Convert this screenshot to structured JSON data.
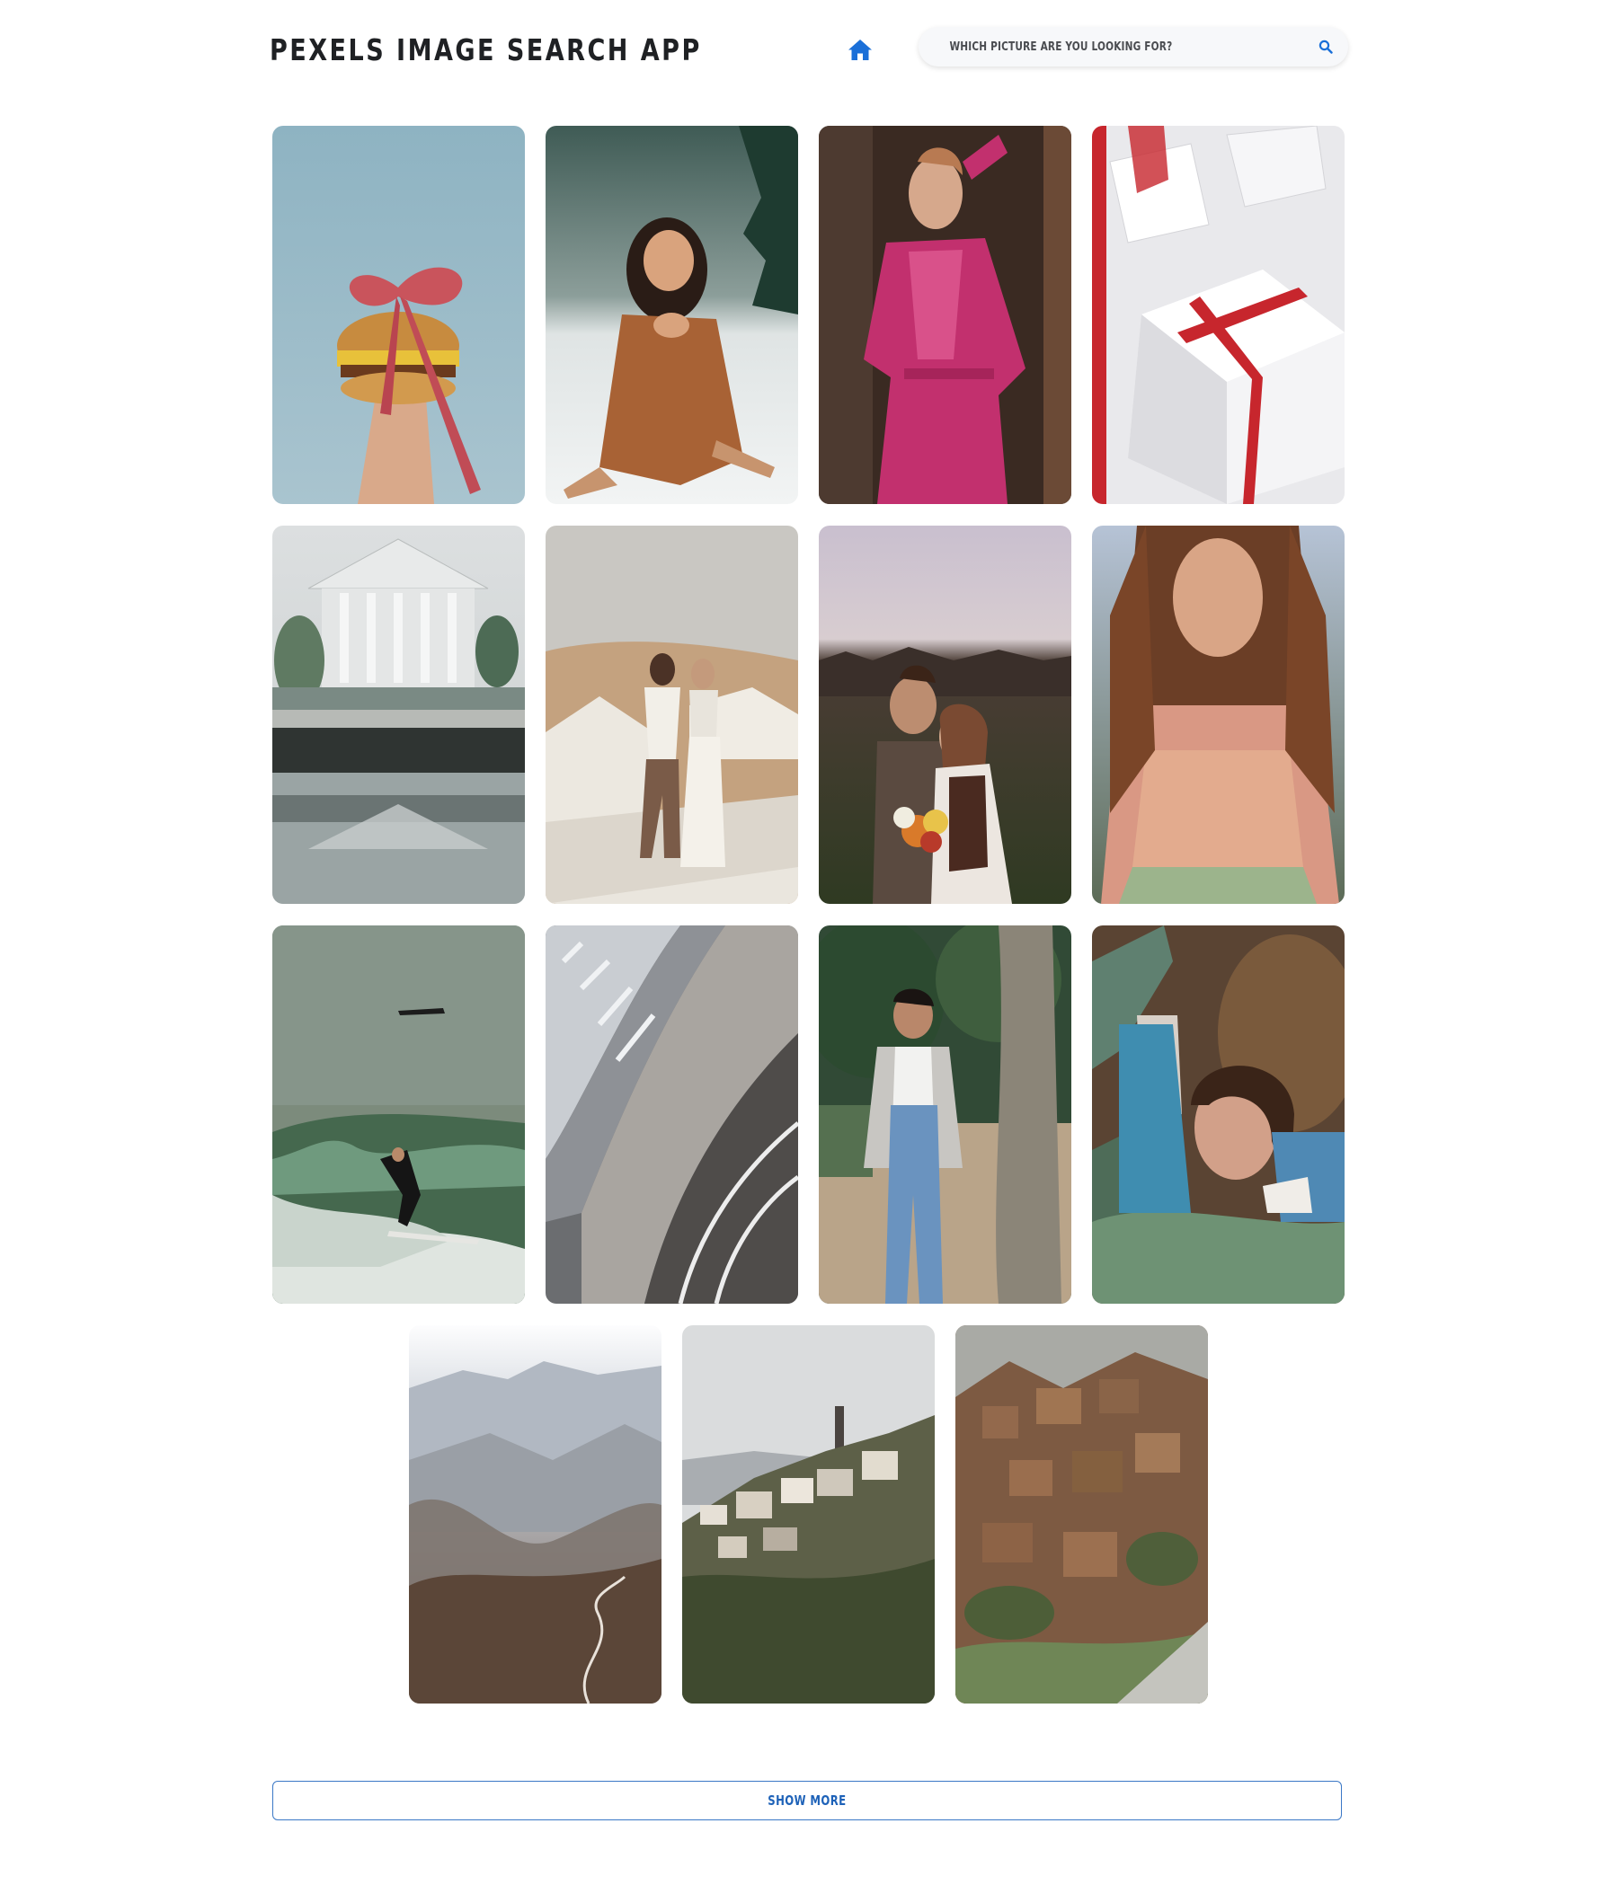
{
  "header": {
    "title": "PEXELS IMAGE SEARCH APP",
    "home_icon": "home-icon",
    "search": {
      "placeholder": "WHICH PICTURE ARE YOU LOOKING FOR?",
      "value": "",
      "icon": "search-icon"
    }
  },
  "colors": {
    "accent": "#1a6fd8",
    "title": "#1f2124",
    "button_border": "#3b78c6"
  },
  "gallery": {
    "photos": [
      {
        "subject": "burger-with-ribbon",
        "alt": "Burger tied with pink ribbon"
      },
      {
        "subject": "girl-in-snow",
        "alt": "Girl sitting in snow"
      },
      {
        "subject": "woman-pink-robe",
        "alt": "Woman in pink robe"
      },
      {
        "subject": "gift-boxes",
        "alt": "White gift boxes with red ribbon"
      },
      {
        "subject": "classical-building-water",
        "alt": "Classical building reflected in water"
      },
      {
        "subject": "couple-desert",
        "alt": "Couple in desert"
      },
      {
        "subject": "couple-flowers",
        "alt": "Couple with flowers"
      },
      {
        "subject": "woman-sweater",
        "alt": "Woman in knit sweater"
      },
      {
        "subject": "surfer-wave",
        "alt": "Surfer on wave"
      },
      {
        "subject": "architecture-curve",
        "alt": "Curved architecture"
      },
      {
        "subject": "boy-overalls",
        "alt": "Boy in overalls by tree"
      },
      {
        "subject": "woman-cactus",
        "alt": "Woman with cactus"
      },
      {
        "subject": "misty-mountains",
        "alt": "Misty mountains"
      },
      {
        "subject": "hillside-village",
        "alt": "Hillside village"
      },
      {
        "subject": "ruined-village",
        "alt": "Ruined hillside village"
      }
    ]
  },
  "show_more_label": "SHOW MORE"
}
